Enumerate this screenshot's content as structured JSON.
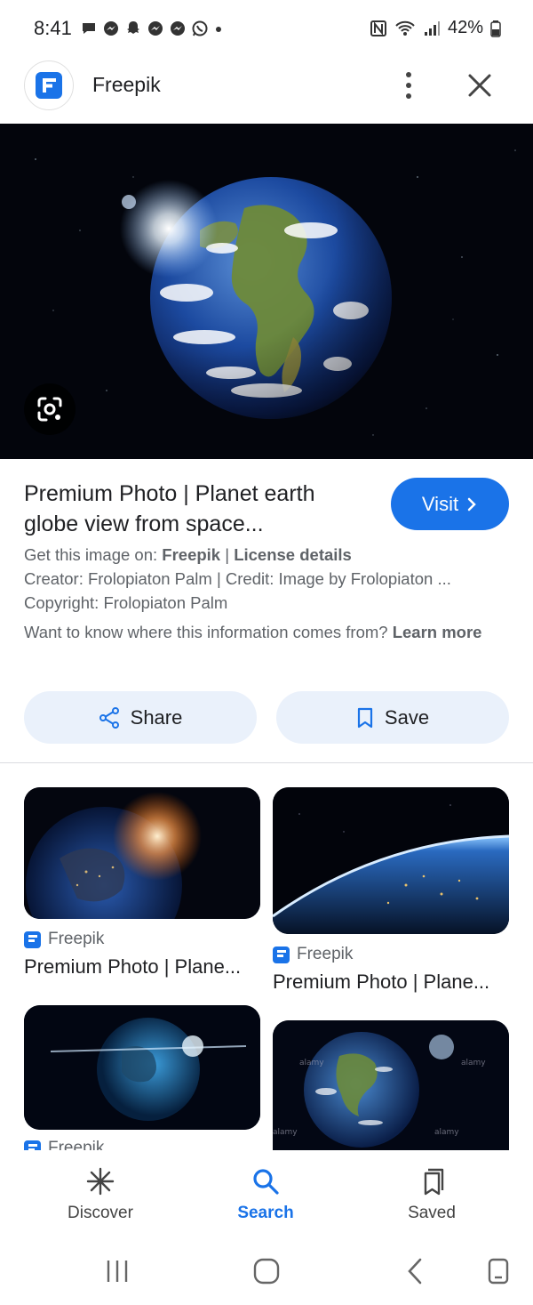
{
  "status_bar": {
    "time": "8:41",
    "battery": "42%"
  },
  "header": {
    "site_name": "Freepik"
  },
  "result": {
    "title": "Premium Photo | Planet earth globe view from space...",
    "visit_label": "Visit",
    "source_prefix": "Get this image on: ",
    "source_name": "Freepik",
    "separator": " | ",
    "license_label": "License details",
    "creator_line": "Creator: Frolopiaton Palm | Credit: Image by Frolopiaton ...",
    "copyright_line": "Copyright: Frolopiaton Palm",
    "info_question": "Want to know where this information comes from? ",
    "learn_more": "Learn more"
  },
  "actions": {
    "share_label": "Share",
    "save_label": "Save"
  },
  "related": [
    {
      "source": "Freepik",
      "caption": "Premium Photo | Plane..."
    },
    {
      "source": "Freepik",
      "caption": "Premium Photo | Plane..."
    },
    {
      "source": "Freepik",
      "caption": ""
    },
    {
      "source": "",
      "caption": ""
    }
  ],
  "watermark": "alamy",
  "bottom_nav": {
    "discover": "Discover",
    "search": "Search",
    "saved": "Saved"
  },
  "colors": {
    "accent": "#1a73e8",
    "button_bg": "#eaf1fb"
  }
}
